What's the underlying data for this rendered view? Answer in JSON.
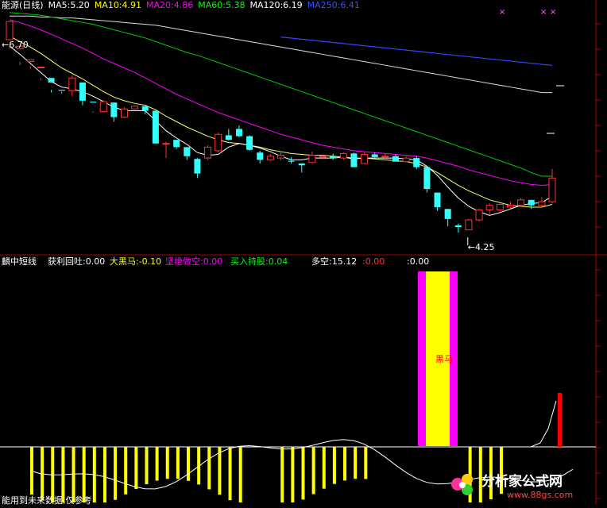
{
  "main": {
    "header": [
      {
        "text": "能源(日线)",
        "color": "#ffffff"
      },
      {
        "text": "MA5:5.20",
        "color": "#ffffff"
      },
      {
        "text": "MA10:4.91",
        "color": "#ffff00"
      },
      {
        "text": "MA20:4.86",
        "color": "#ff00ff"
      },
      {
        "text": "MA60:5.38",
        "color": "#00ff00"
      },
      {
        "text": "MA120:6.19",
        "color": "#ffffff"
      },
      {
        "text": "MA250:6.41",
        "color": "#3355ff"
      }
    ],
    "high_label": "6.70",
    "low_label": "4.25",
    "candles": [
      [
        7.02,
        7.22,
        6.95,
        6.92
      ],
      [
        6.92,
        6.95,
        6.78,
        6.74
      ],
      [
        6.78,
        6.8,
        6.73,
        6.7
      ],
      [
        6.72,
        6.72,
        6.6,
        6.58
      ],
      [
        6.6,
        6.55,
        6.47,
        6.44
      ],
      [
        6.47,
        6.46,
        6.45,
        6.43
      ],
      [
        6.46,
        6.6,
        6.63,
        6.4
      ],
      [
        6.55,
        6.35,
        6.37,
        6.3
      ],
      [
        6.34,
        6.33,
        6.23,
        6.22
      ],
      [
        6.23,
        6.34,
        6.36,
        6.22
      ],
      [
        6.33,
        6.17,
        6.2,
        6.12
      ],
      [
        6.17,
        6.26,
        6.28,
        6.16
      ],
      [
        6.26,
        6.29,
        6.3,
        6.25
      ],
      [
        6.29,
        6.24,
        6.25,
        6.2
      ],
      [
        6.24,
        5.88,
        6.24,
        5.88
      ],
      [
        5.88,
        5.88,
        5.9,
        5.72
      ],
      [
        5.92,
        5.84,
        5.92,
        5.82
      ],
      [
        5.84,
        5.74,
        5.78,
        5.7
      ],
      [
        5.71,
        5.55,
        5.72,
        5.5
      ],
      [
        5.72,
        5.84,
        5.86,
        5.7
      ],
      [
        5.8,
        5.98,
        6.0,
        5.78
      ],
      [
        5.97,
        5.92,
        6.04,
        5.91
      ],
      [
        6.04,
        5.96,
        6.08,
        5.95
      ],
      [
        5.96,
        5.81,
        5.97,
        5.8
      ],
      [
        5.78,
        5.7,
        5.8,
        5.66
      ],
      [
        5.7,
        5.74,
        5.76,
        5.69
      ],
      [
        5.72,
        5.75,
        5.78,
        5.7
      ],
      [
        5.69,
        5.68,
        5.73,
        5.66
      ],
      [
        5.66,
        5.64,
        5.66,
        5.56
      ],
      [
        5.67,
        5.75,
        5.79,
        5.67
      ],
      [
        5.73,
        5.74,
        5.75,
        5.72
      ],
      [
        5.74,
        5.72,
        5.77,
        5.7
      ],
      [
        5.72,
        5.77,
        5.78,
        5.7
      ],
      [
        5.77,
        5.62,
        5.78,
        5.62
      ],
      [
        5.66,
        5.76,
        5.78,
        5.66
      ],
      [
        5.76,
        5.73,
        5.78,
        5.71
      ],
      [
        5.74,
        5.74,
        5.77,
        5.72
      ],
      [
        5.74,
        5.68,
        5.76,
        5.68
      ],
      [
        5.68,
        5.72,
        5.74,
        5.68
      ],
      [
        5.72,
        5.62,
        5.74,
        5.6
      ],
      [
        5.62,
        5.38,
        5.63,
        5.34
      ],
      [
        5.34,
        5.18,
        5.34,
        5.14
      ],
      [
        5.16,
        5.05,
        5.16,
        4.97
      ],
      [
        4.98,
        4.96,
        5.0,
        4.9
      ],
      [
        4.93,
        5.04,
        5.05,
        4.93
      ],
      [
        5.04,
        5.15,
        5.16,
        5.02
      ],
      [
        5.15,
        5.2,
        5.22,
        5.1
      ],
      [
        5.15,
        5.21,
        5.22,
        5.13
      ],
      [
        5.18,
        5.2,
        5.24,
        5.16
      ],
      [
        5.2,
        5.26,
        5.28,
        5.18
      ],
      [
        5.26,
        5.2,
        5.26,
        5.16
      ],
      [
        5.2,
        5.24,
        5.29,
        5.18
      ],
      [
        5.24,
        5.5,
        5.6,
        5.22
      ]
    ],
    "yrange": [
      4.7,
      7.3
    ],
    "ma5": [
      6.95,
      6.86,
      6.76,
      6.66,
      6.56,
      6.5,
      6.48,
      6.45,
      6.4,
      6.34,
      6.28,
      6.24,
      6.24,
      6.24,
      6.13,
      6.02,
      5.94,
      5.87,
      5.78,
      5.75,
      5.76,
      5.84,
      5.88,
      5.86,
      5.83,
      5.79,
      5.74,
      5.7,
      5.7,
      5.72,
      5.72,
      5.72,
      5.73,
      5.71,
      5.72,
      5.72,
      5.72,
      5.72,
      5.71,
      5.7,
      5.63,
      5.53,
      5.4,
      5.28,
      5.19,
      5.13,
      5.09,
      5.12,
      5.16,
      5.2,
      5.22,
      5.23,
      5.3
    ],
    "ma10": [
      7.06,
      7.0,
      6.94,
      6.87,
      6.79,
      6.71,
      6.65,
      6.59,
      6.52,
      6.45,
      6.39,
      6.35,
      6.32,
      6.3,
      6.25,
      6.18,
      6.12,
      6.06,
      6.01,
      5.96,
      5.92,
      5.89,
      5.88,
      5.86,
      5.84,
      5.81,
      5.79,
      5.77,
      5.76,
      5.75,
      5.75,
      5.74,
      5.73,
      5.72,
      5.72,
      5.71,
      5.7,
      5.69,
      5.68,
      5.66,
      5.62,
      5.56,
      5.49,
      5.42,
      5.36,
      5.31,
      5.26,
      5.23,
      5.2,
      5.19,
      5.18,
      5.18,
      5.21
    ],
    "ma20": [
      7.24,
      7.21,
      7.17,
      7.13,
      7.08,
      7.03,
      6.98,
      6.93,
      6.87,
      6.81,
      6.76,
      6.71,
      6.66,
      6.6,
      6.54,
      6.48,
      6.42,
      6.37,
      6.32,
      6.27,
      6.22,
      6.18,
      6.14,
      6.1,
      6.06,
      6.02,
      5.98,
      5.95,
      5.92,
      5.89,
      5.86,
      5.84,
      5.82,
      5.8,
      5.79,
      5.78,
      5.77,
      5.76,
      5.75,
      5.74,
      5.72,
      5.69,
      5.66,
      5.63,
      5.59,
      5.56,
      5.53,
      5.5,
      5.47,
      5.45,
      5.43,
      5.42,
      5.43
    ],
    "ma60": [
      7.32,
      7.31,
      7.3,
      7.29,
      7.27,
      7.25,
      7.23,
      7.21,
      7.19,
      7.16,
      7.13,
      7.1,
      7.07,
      7.04,
      7.0,
      6.96,
      6.92,
      6.88,
      6.85,
      6.81,
      6.77,
      6.73,
      6.69,
      6.65,
      6.61,
      6.57,
      6.53,
      6.49,
      6.45,
      6.41,
      6.37,
      6.33,
      6.29,
      6.25,
      6.21,
      6.17,
      6.13,
      6.09,
      6.05,
      6.01,
      5.97,
      5.93,
      5.89,
      5.85,
      5.81,
      5.77,
      5.73,
      5.69,
      5.65,
      5.61,
      5.56,
      5.52,
      5.52
    ],
    "ma120": [
      7.28,
      7.28,
      7.28,
      7.27,
      7.27,
      7.26,
      7.26,
      7.25,
      7.24,
      7.23,
      7.22,
      7.21,
      7.2,
      7.19,
      7.18,
      7.16,
      7.14,
      7.12,
      7.1,
      7.08,
      7.06,
      7.04,
      7.02,
      7.0,
      6.98,
      6.96,
      6.94,
      6.92,
      6.9,
      6.88,
      6.86,
      6.84,
      6.82,
      6.8,
      6.78,
      6.76,
      6.74,
      6.72,
      6.7,
      6.68,
      6.66,
      6.64,
      6.62,
      6.6,
      6.58,
      6.56,
      6.54,
      6.52,
      6.5,
      6.48,
      6.46,
      6.44,
      6.44
    ],
    "ma250_start": 26
  },
  "indicator": {
    "header": [
      {
        "text": "麟中短线",
        "color": "#ffffff"
      },
      {
        "text": "获利回吐:0.00",
        "color": "#ffffff"
      },
      {
        "text": "大黑马:-0.10",
        "color": "#ffff00"
      },
      {
        "text": "坚绝做空:0.00",
        "color": "#ff00ff"
      },
      {
        "text": "买入持股:0.04",
        "color": "#00ff00"
      },
      {
        "text": "多空:15.12",
        "color": "#ffffff"
      },
      {
        "text": ":0.00",
        "color": "#ff3333"
      },
      {
        "text": ":0.00",
        "color": "#ffffff"
      }
    ],
    "signal_label": "黑马",
    "bottom_text": "能用到未来数据,仅参考",
    "yellow_bars": [
      1,
      1,
      1,
      1,
      1,
      1,
      1,
      1,
      1,
      1,
      1,
      1,
      1,
      1,
      1,
      1,
      1,
      1,
      1,
      1,
      1,
      0,
      0,
      0,
      1,
      1,
      1,
      1,
      1,
      1,
      1,
      1,
      1,
      0,
      0,
      0,
      0,
      0,
      0,
      0,
      0,
      0,
      1,
      1,
      1,
      1,
      0,
      0,
      0,
      0,
      0,
      0,
      0
    ]
  },
  "watermark": {
    "text": "分析家公式网",
    "url_text": "www.88gs.com"
  }
}
